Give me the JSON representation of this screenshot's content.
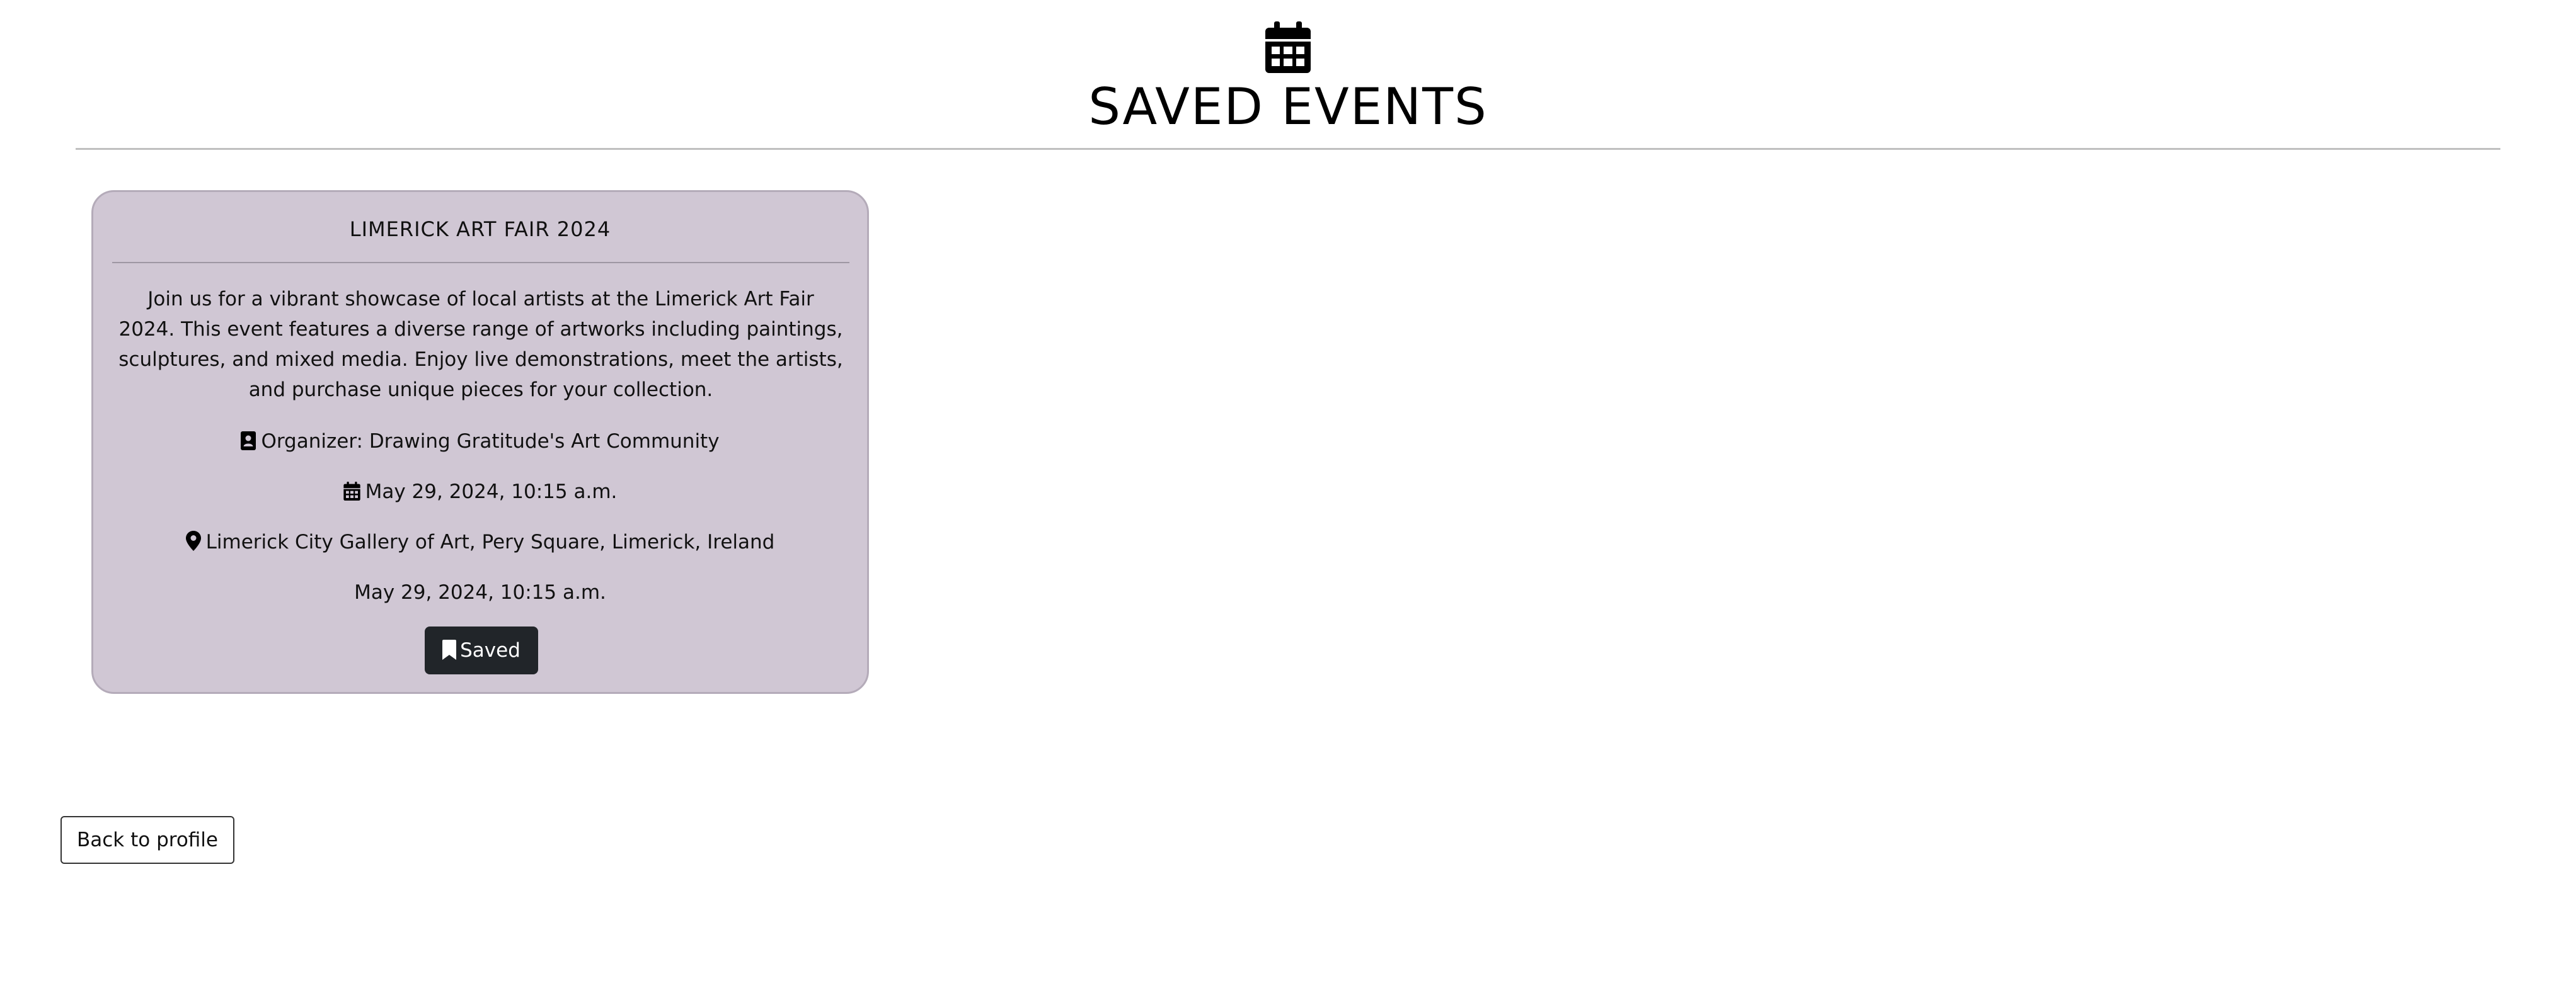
{
  "header": {
    "icon": "calendar-icon",
    "title": "SAVED EVENTS"
  },
  "events": [
    {
      "title": "LIMERICK ART FAIR 2024",
      "description": "Join us for a vibrant showcase of local artists at the Limerick Art Fair 2024. This event features a diverse range of artworks including paintings, sculptures, and mixed media. Enjoy live demonstrations, meet the artists, and purchase unique pieces for your collection.",
      "organizer": "Organizer: Drawing Gratitude's Art Community",
      "date": "May 29, 2024, 10:15 a.m.",
      "location": "Limerick City Gallery of Art, Pery Square, Limerick, Ireland",
      "date_secondary": "May 29, 2024, 10:15 a.m.",
      "saved_label": "Saved",
      "icons": {
        "organizer": "contact-card-icon",
        "date": "calendar-icon",
        "location": "map-pin-icon",
        "saved": "bookmark-icon"
      }
    }
  ],
  "footer": {
    "back_label": "Back to profile"
  },
  "colors": {
    "card_background": "#d0c7d4",
    "card_border": "#b4abb9",
    "saved_button": "#212529",
    "divider": "#bfbfbf"
  }
}
